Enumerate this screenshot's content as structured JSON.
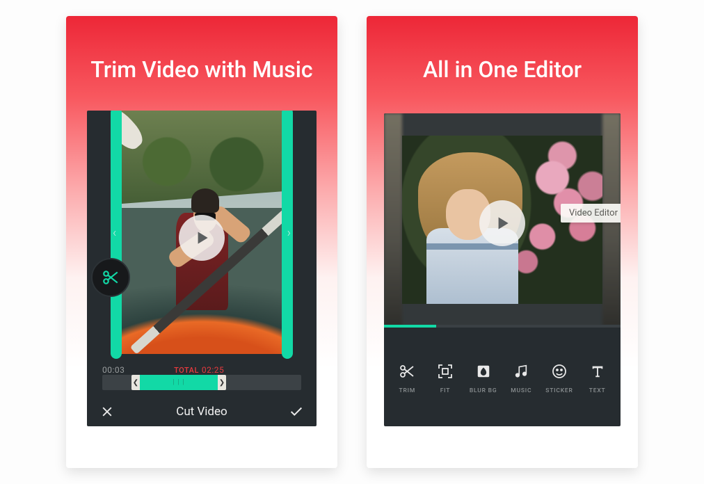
{
  "phone1": {
    "title": "Trim Video with Music",
    "start_time": "00:03",
    "total_prefix": "TOTAL",
    "total_time": "02:25",
    "bottom_label": "Cut Video"
  },
  "phone2": {
    "title": "All in One Editor",
    "tooltip": "Video Editor",
    "tools": [
      {
        "label": "TRIM",
        "icon": "scissors"
      },
      {
        "label": "FIT",
        "icon": "fit"
      },
      {
        "label": "BLUR BG",
        "icon": "blur"
      },
      {
        "label": "MUSIC",
        "icon": "music"
      },
      {
        "label": "STICKER",
        "icon": "sticker"
      },
      {
        "label": "TEXT",
        "icon": "text"
      }
    ]
  },
  "colors": {
    "accent": "#12d9a6",
    "danger": "#e73a3e"
  }
}
